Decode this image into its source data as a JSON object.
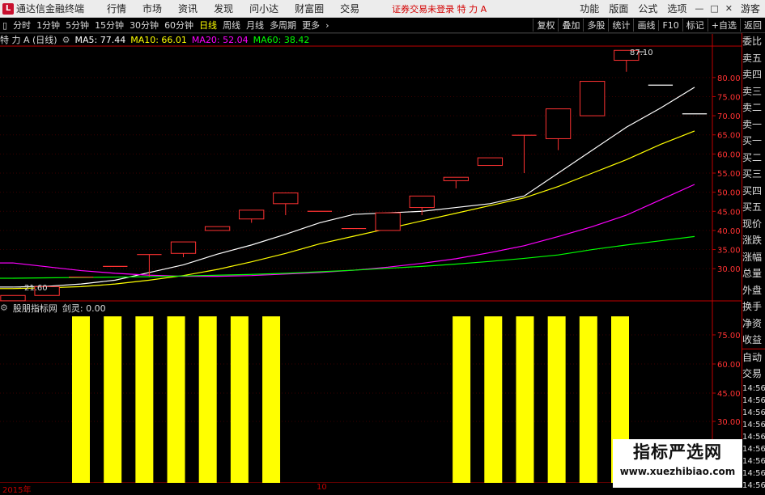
{
  "menubar": {
    "app_title": "通达信金融终端",
    "menus": [
      "行情",
      "市场",
      "资讯",
      "发现",
      "问小达",
      "财富圈",
      "交易"
    ],
    "status": "证券交易未登录  特 力 A",
    "right_items": [
      "功能",
      "版面",
      "公式",
      "选项"
    ],
    "guest": "游客"
  },
  "toolbar": {
    "periods": [
      "分时",
      "1分钟",
      "5分钟",
      "15分钟",
      "30分钟",
      "60分钟",
      "日线",
      "周线",
      "月线",
      "多周期",
      "更多"
    ],
    "active_period": "日线",
    "right_buttons": [
      "复权",
      "叠加",
      "多股",
      "统计",
      "画线",
      "F10",
      "标记",
      "+自选",
      "返回"
    ]
  },
  "main_chart": {
    "stock": "特 力 A (日线)",
    "ma_labels": [
      {
        "text": "MA5: 77.44",
        "color": "#ffffff"
      },
      {
        "text": "MA10: 66.01",
        "color": "#ffff00"
      },
      {
        "text": "MA20: 52.04",
        "color": "#ff00ff"
      },
      {
        "text": "MA60: 38.42",
        "color": "#00ff00"
      }
    ],
    "high_label": "87.10",
    "low_label": "21.60",
    "y_ticks": [
      "80.00",
      "75.00",
      "70.00",
      "65.00",
      "60.00",
      "55.00",
      "50.00",
      "45.00",
      "40.00",
      "35.00",
      "30.00"
    ]
  },
  "sub_chart": {
    "indicator": "股朋指标网",
    "value": "剑灵: 0.00",
    "y_ticks": [
      "75.00",
      "60.00",
      "45.00",
      "30.00"
    ]
  },
  "right_panel": {
    "items": [
      "委比",
      "卖五",
      "卖四",
      "卖三",
      "卖二",
      "卖一",
      "买一",
      "买二",
      "买三",
      "买四",
      "买五",
      "现价",
      "涨跌",
      "涨幅",
      "总量",
      "外盘",
      "换手",
      "净资",
      "收益"
    ],
    "lower_items": [
      "自动",
      "交易"
    ],
    "times": [
      "14:56",
      "14:56",
      "14:56",
      "14:56",
      "14:56",
      "14:56",
      "14:56",
      "14:56",
      "14:56"
    ]
  },
  "bottom_axis": {
    "left": "2015年",
    "mid": "10"
  },
  "watermark": {
    "line1": "指标严选网",
    "line2": "www.xuezhibiao.com"
  },
  "colors": {
    "up": "#ff3232",
    "bar": "#ffff00",
    "axis": "#c00000"
  },
  "chart_data": [
    {
      "type": "candlestick",
      "title": "特 力 A (日线)",
      "candles": [
        {
          "open": 21.6,
          "high": 23.0,
          "low": 21.6,
          "close": 23.0
        },
        {
          "open": 23.0,
          "high": 25.3,
          "low": 23.0,
          "close": 25.3
        },
        {
          "open": 27.8,
          "high": 27.8,
          "low": 27.8,
          "close": 27.8
        },
        {
          "open": 30.6,
          "high": 30.6,
          "low": 30.6,
          "close": 30.6
        },
        {
          "open": 33.7,
          "high": 33.7,
          "low": 28.0,
          "close": 33.7
        },
        {
          "open": 34.0,
          "high": 37.0,
          "low": 33.0,
          "close": 37.0
        },
        {
          "open": 40.0,
          "high": 41.0,
          "low": 40.0,
          "close": 41.0
        },
        {
          "open": 43.0,
          "high": 45.3,
          "low": 42.0,
          "close": 45.3
        },
        {
          "open": 47.0,
          "high": 49.8,
          "low": 44.0,
          "close": 49.8
        },
        {
          "open": 45.0,
          "high": 45.0,
          "low": 45.0,
          "close": 45.0
        },
        {
          "open": 40.5,
          "high": 40.5,
          "low": 40.5,
          "close": 40.5
        },
        {
          "open": 40.0,
          "high": 44.6,
          "low": 40.0,
          "close": 44.6
        },
        {
          "open": 46.0,
          "high": 49.0,
          "low": 44.0,
          "close": 49.0
        },
        {
          "open": 53.0,
          "high": 53.9,
          "low": 51.0,
          "close": 53.9
        },
        {
          "open": 57.0,
          "high": 59.0,
          "low": 57.0,
          "close": 59.0
        },
        {
          "open": 64.9,
          "high": 64.9,
          "low": 55.0,
          "close": 64.9
        },
        {
          "open": 64.0,
          "high": 71.8,
          "low": 61.0,
          "close": 71.8
        },
        {
          "open": 70.0,
          "high": 79.0,
          "low": 70.0,
          "close": 79.0
        },
        {
          "open": 84.5,
          "high": 87.1,
          "low": 81.5,
          "close": 87.1
        },
        {
          "open": 78.0,
          "high": 78.0,
          "low": 78.0,
          "close": 78.0
        },
        {
          "open": 70.5,
          "high": 70.5,
          "low": 70.5,
          "close": 70.5
        }
      ],
      "ma": [
        {
          "name": "MA5",
          "color": "#ffffff",
          "values": [
            25.2,
            25.4,
            26.0,
            27.0,
            29.0,
            31.0,
            33.8,
            36.2,
            39.0,
            42.0,
            44.2,
            44.6,
            45.0,
            46.0,
            47.0,
            49.0,
            55.0,
            61.0,
            67.0,
            72.0,
            77.44
          ]
        },
        {
          "name": "MA10",
          "color": "#ffff00",
          "values": [
            24.8,
            25.0,
            25.3,
            26.0,
            27.0,
            28.2,
            29.8,
            31.8,
            34.0,
            36.5,
            38.5,
            40.5,
            42.5,
            44.5,
            46.5,
            48.5,
            51.5,
            55.0,
            58.5,
            62.5,
            66.01
          ]
        },
        {
          "name": "MA20",
          "color": "#ff00ff",
          "values": [
            31.5,
            30.5,
            29.5,
            28.8,
            28.3,
            28.0,
            28.0,
            28.2,
            28.6,
            29.0,
            29.6,
            30.4,
            31.4,
            32.6,
            34.2,
            36.0,
            38.4,
            41.0,
            44.0,
            48.0,
            52.04
          ]
        },
        {
          "name": "MA60",
          "color": "#00ff00",
          "values": [
            27.5,
            27.6,
            27.7,
            27.8,
            27.9,
            28.1,
            28.3,
            28.5,
            28.8,
            29.2,
            29.6,
            30.1,
            30.6,
            31.2,
            31.9,
            32.7,
            33.6,
            35.0,
            36.2,
            37.3,
            38.42
          ]
        }
      ],
      "ylim": [
        22.0,
        88.0
      ]
    },
    {
      "type": "bar",
      "title": "股朋指标网",
      "values": [
        100,
        100,
        100,
        100,
        100,
        100,
        100,
        0,
        0,
        0,
        0,
        0,
        100,
        100,
        100,
        100,
        100,
        100
      ],
      "ylim": [
        0,
        100
      ]
    }
  ]
}
